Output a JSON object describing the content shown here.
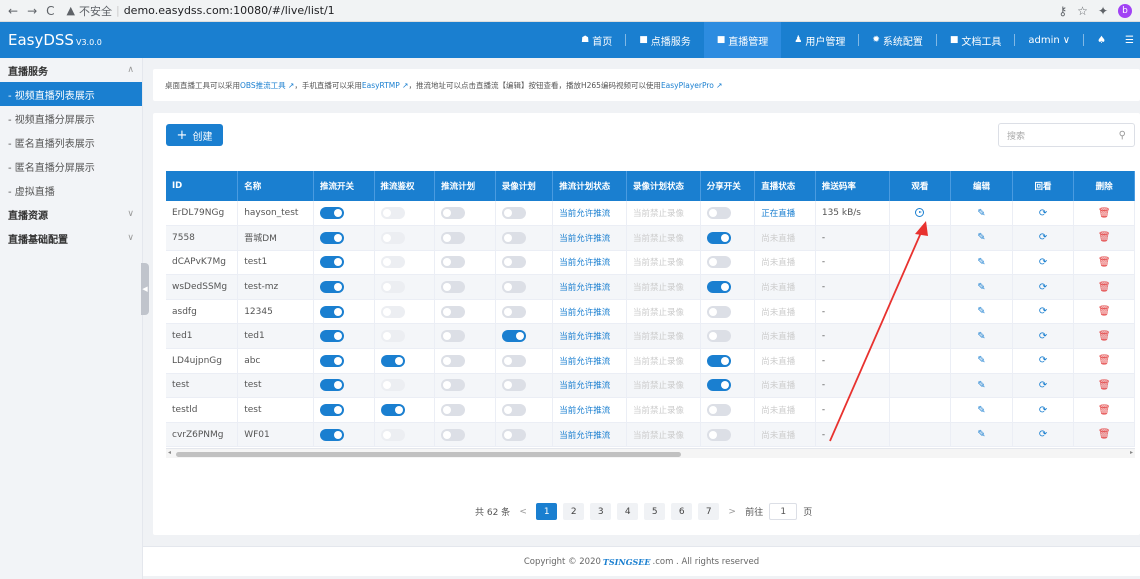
{
  "browser": {
    "nav_back": "←",
    "nav_fwd": "→",
    "nav_reload": "C",
    "warning_icon": "▲",
    "security_text": "不安全",
    "url": "demo.easydss.com:10080/#/live/list/1",
    "profile_letter": "b"
  },
  "header": {
    "brand": "EasyDSS",
    "version": "V3.0.0",
    "menus": [
      {
        "label": "首页",
        "icon": "home-icon",
        "glyph": "☗"
      },
      {
        "label": "点播服务",
        "icon": "video-icon",
        "glyph": "■"
      },
      {
        "label": "直播管理",
        "icon": "live-icon",
        "glyph": "■",
        "active": true
      },
      {
        "label": "用户管理",
        "icon": "user-icon",
        "glyph": "♟"
      },
      {
        "label": "系统配置",
        "icon": "gear-icon",
        "glyph": "✹"
      },
      {
        "label": "文档工具",
        "icon": "doc-icon",
        "glyph": "■"
      }
    ],
    "user": "admin",
    "user_chevron": "∨",
    "bell_glyph": "♠",
    "more_glyph": "☰"
  },
  "sidebar": {
    "groups": [
      {
        "label": "直播服务",
        "chev": "∧",
        "items": [
          {
            "label": "- 视频直播列表展示",
            "active": true
          },
          {
            "label": "- 视频直播分屏展示"
          },
          {
            "label": "- 匿名直播列表展示"
          },
          {
            "label": "- 匿名直播分屏展示"
          },
          {
            "label": "- 虚拟直播"
          }
        ]
      },
      {
        "label": "直播资源",
        "chev": "∨",
        "items": []
      },
      {
        "label": "直播基础配置",
        "chev": "∨",
        "items": []
      }
    ],
    "collapse_glyph": "◀"
  },
  "notice": {
    "p1": "桌面直播工具可以采用 ",
    "l1": "OBS推流工具",
    "p2": "，手机直播可以采用 ",
    "l2": "EasyRTMP",
    "p3": "，推流地址可以点击直播流【编辑】按钮查看，播放H265编码视频可以使用 ",
    "l3": "EasyPlayerPro",
    "ext": "↗"
  },
  "toolbar": {
    "create_icon": "+",
    "create_label": "创建",
    "search_placeholder": "搜索",
    "search_icon": "⚲"
  },
  "table": {
    "headers": [
      "ID",
      "名称",
      "推流开关",
      "推流鉴权",
      "推流计划",
      "录像计划",
      "推流计划状态",
      "录像计划状态",
      "分享开关",
      "直播状态",
      "推送码率",
      "观看",
      "编辑",
      "回看",
      "删除"
    ],
    "rows": [
      {
        "id": "ErDL79NGg",
        "name": "hayson_test",
        "push": true,
        "auth": false,
        "plan": false,
        "rec": false,
        "pstat": "当前允许推流",
        "rstat": "当前禁止录像",
        "share": false,
        "live": "正在直播",
        "live_on": true,
        "rate": "135 kB/s",
        "watch": true
      },
      {
        "id": "7558",
        "name": "晋城DM",
        "push": true,
        "auth": false,
        "plan": false,
        "rec": false,
        "pstat": "当前允许推流",
        "rstat": "当前禁止录像",
        "share": true,
        "live": "尚未直播",
        "live_on": false,
        "rate": "-",
        "watch": false
      },
      {
        "id": "dCAPvK7Mg",
        "name": "test1",
        "push": true,
        "auth": false,
        "plan": false,
        "rec": false,
        "pstat": "当前允许推流",
        "rstat": "当前禁止录像",
        "share": false,
        "live": "尚未直播",
        "live_on": false,
        "rate": "-",
        "watch": false
      },
      {
        "id": "wsDedSSMg",
        "name": "test-mz",
        "push": true,
        "auth": false,
        "plan": false,
        "rec": false,
        "pstat": "当前允许推流",
        "rstat": "当前禁止录像",
        "share": true,
        "live": "尚未直播",
        "live_on": false,
        "rate": "-",
        "watch": false
      },
      {
        "id": "asdfg",
        "name": "12345",
        "push": true,
        "auth": false,
        "plan": false,
        "rec": false,
        "pstat": "当前允许推流",
        "rstat": "当前禁止录像",
        "share": false,
        "live": "尚未直播",
        "live_on": false,
        "rate": "-",
        "watch": false
      },
      {
        "id": "ted1",
        "name": "ted1",
        "push": true,
        "auth": false,
        "plan": false,
        "rec": true,
        "pstat": "当前允许推流",
        "rstat": "当前禁止录像",
        "share": false,
        "live": "尚未直播",
        "live_on": false,
        "rate": "-",
        "watch": false
      },
      {
        "id": "LD4ujpnGg",
        "name": "abc",
        "push": true,
        "auth": true,
        "plan": false,
        "rec": false,
        "pstat": "当前允许推流",
        "rstat": "当前禁止录像",
        "share": true,
        "live": "尚未直播",
        "live_on": false,
        "rate": "-",
        "watch": false
      },
      {
        "id": "test",
        "name": "test",
        "push": true,
        "auth": false,
        "plan": false,
        "rec": false,
        "pstat": "当前允许推流",
        "rstat": "当前禁止录像",
        "share": true,
        "live": "尚未直播",
        "live_on": false,
        "rate": "-",
        "watch": false
      },
      {
        "id": "testld",
        "name": "test",
        "push": true,
        "auth": true,
        "plan": false,
        "rec": false,
        "pstat": "当前允许推流",
        "rstat": "当前禁止录像",
        "share": false,
        "live": "尚未直播",
        "live_on": false,
        "rate": "-",
        "watch": false
      },
      {
        "id": "cvrZ6PNMg",
        "name": "WF01",
        "push": true,
        "auth": false,
        "plan": false,
        "rec": false,
        "pstat": "当前允许推流",
        "rstat": "当前禁止录像",
        "share": false,
        "live": "尚未直播",
        "live_on": false,
        "rate": "-",
        "watch": false
      }
    ],
    "edit_glyph": "✎",
    "replay_glyph": "⟳",
    "delete_glyph": "🗑",
    "scroll_left": "◂",
    "scroll_right": "▸"
  },
  "pagination": {
    "total": "共 62 条",
    "prev": "<",
    "next": ">",
    "pages": [
      "1",
      "2",
      "3",
      "4",
      "5",
      "6",
      "7"
    ],
    "current": "1",
    "goto_prefix": "前往",
    "goto_value": "1",
    "goto_suffix": "页"
  },
  "footer": {
    "prefix": "Copyright © 2020 ",
    "brand": "TSINGSEE",
    "suffix": ".com . All rights reserved"
  },
  "colors": {
    "brand_blue": "#1a7fd0",
    "annotation_red": "#e8322f",
    "delete_red": "#e23c3c"
  }
}
